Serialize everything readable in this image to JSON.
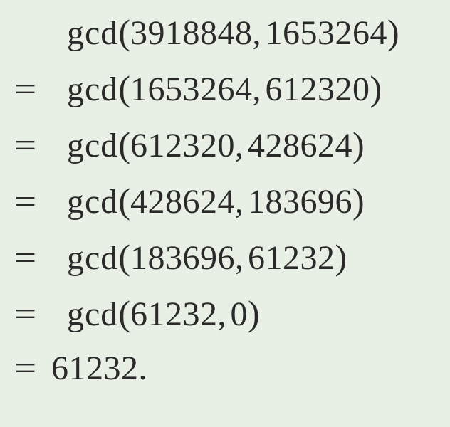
{
  "math": {
    "fn": "gcd",
    "eq": "=",
    "open": "(",
    "close": ")",
    "comma": ",",
    "period": ".",
    "lines": [
      {
        "a": "3918848",
        "b": "1653264"
      },
      {
        "a": "1653264",
        "b": "612320"
      },
      {
        "a": "612320",
        "b": "428624"
      },
      {
        "a": "428624",
        "b": "183696"
      },
      {
        "a": "183696",
        "b": "61232"
      },
      {
        "a": "61232",
        "b": "0"
      }
    ],
    "result": "61232"
  }
}
